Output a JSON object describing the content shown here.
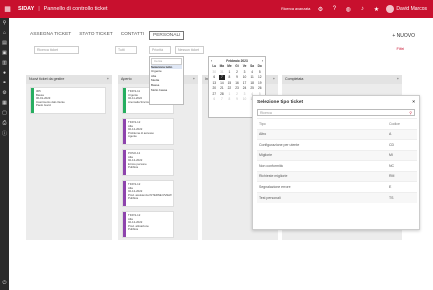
{
  "topbar": {
    "app": "SIDAY",
    "title": "Pannello di controllo ticket",
    "status": "Ricerca avanzata",
    "user": "David Marcos"
  },
  "icons": {
    "logo": "siday-logo-icon",
    "left": [
      "search-icon",
      "home-icon",
      "chart-icon",
      "folder-icon",
      "ticket-icon",
      "user-icon",
      "link-icon",
      "gear-icon",
      "calendar-icon",
      "doc-icon",
      "print-icon",
      "info-icon"
    ]
  },
  "tabs": [
    "ASSEGNA TICKET",
    "STATO TICKET",
    "CONTATTI",
    "PERSONALI"
  ],
  "new_button": "+ NUOVO",
  "filters": {
    "search_placeholder": "Ricerca ticket",
    "tipo": "Tutti",
    "priority": "Priorità",
    "assign": "Nessun ticket",
    "filtri": "Filtri"
  },
  "dropdown": {
    "search": "Cerca",
    "items": [
      "Seleziona tutto",
      "Urgente",
      "Alta",
      "Media",
      "Bassa",
      "Molto bassa"
    ]
  },
  "calendar": {
    "month": "Febbraio 2023",
    "days": [
      "Lu",
      "Ma",
      "Me",
      "Gi",
      "Ve",
      "Sa",
      "Do"
    ],
    "dates": [
      "30",
      "31",
      "1",
      "2",
      "3",
      "4",
      "5",
      "6",
      "7",
      "8",
      "9",
      "10",
      "11",
      "12",
      "13",
      "14",
      "15",
      "16",
      "17",
      "18",
      "19",
      "20",
      "21",
      "22",
      "23",
      "24",
      "25",
      "26",
      "27",
      "28",
      "1",
      "2",
      "3",
      "4",
      "5",
      "6",
      "7",
      "8",
      "9",
      "10",
      "11",
      "12"
    ],
    "today_index": 8
  },
  "columns": [
    {
      "title": "Nuovi ticket da gestire",
      "cards": [
        {
          "id": "305",
          "prio": "Bassa",
          "date": "06-01-2023",
          "desc": "Inserimento dati cliente",
          "agent": "Paolo Gucci",
          "color": "#27ae60"
        }
      ]
    },
    {
      "title": "Aperto",
      "cards": [
        {
          "id": "TICKS-11",
          "prio": "Urgente",
          "date": "02-11-2022",
          "desc": "Anomalia Sincronizzazione",
          "agent": "",
          "color": "#27ae60"
        },
        {
          "id": "TICKS-12",
          "prio": "Alta",
          "date": "02-12-2022",
          "desc": "Problema di accesso",
          "agent": "Agente",
          "color": "#8e44ad"
        },
        {
          "id": "POSO-12",
          "prio": "Alta",
          "date": "02-12-2022",
          "desc": "Errore persone",
          "agent": "Pubbica",
          "color": "#8e44ad"
        },
        {
          "id": "TICKS-12",
          "prio": "Alta",
          "date": "02-12-2022",
          "desc": "Prod. assistenza INTERNE RVIEW",
          "agent": "Pubbica",
          "color": "#8e44ad"
        },
        {
          "id": "TICKS-12",
          "prio": "Alta",
          "date": "02-12-2022",
          "desc": "Prod. attivazione",
          "agent": "Pubbica",
          "color": "#8e44ad"
        }
      ]
    },
    {
      "title": "In lavorazione",
      "cards": []
    },
    {
      "title": "Completata",
      "cards": []
    }
  ],
  "modal": {
    "title": "Selezione tipo ticket",
    "search": "Ricerca",
    "header": [
      "Tipo",
      "Codice"
    ],
    "rows": [
      [
        "Altro",
        "A"
      ],
      [
        "Configurazione per utente",
        "CD"
      ],
      [
        "Migliorie",
        "MI"
      ],
      [
        "Non conformità",
        "NC"
      ],
      [
        "Richieste migliorie",
        "RM"
      ],
      [
        "Segnalazione errore",
        "E"
      ],
      [
        "Test personali",
        "TS"
      ]
    ]
  }
}
